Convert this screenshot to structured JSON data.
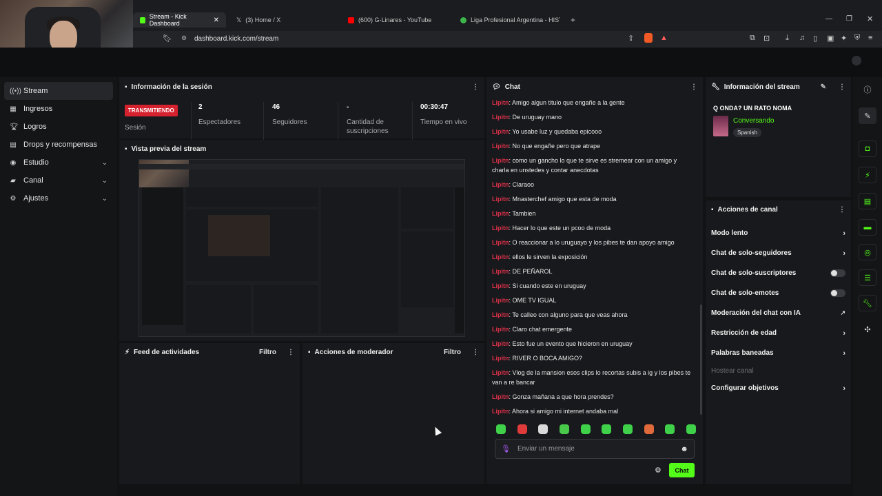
{
  "browser": {
    "tabs": [
      {
        "label": "Stream - Kick Dashboard",
        "active": true,
        "icon": "kick-icon",
        "color": "#53fc18"
      },
      {
        "label": "(3) Home / X",
        "active": false,
        "icon": "x-icon",
        "color": "#ffffff"
      },
      {
        "label": "(600) G-Linares - YouTube",
        "active": false,
        "icon": "youtube-icon",
        "color": "#ff0000"
      },
      {
        "label": "Liga Profesional Argentina - HISTORI",
        "active": false,
        "icon": "lpf-icon",
        "color": "#3db54a"
      }
    ],
    "url": "dashboard.kick.com/stream"
  },
  "sidebar": {
    "items": [
      {
        "label": "Stream",
        "icon": "broadcast-icon",
        "active": true,
        "chevron": false
      },
      {
        "label": "Ingresos",
        "icon": "dollar-icon",
        "active": false,
        "chevron": false
      },
      {
        "label": "Logros",
        "icon": "trophy-icon",
        "active": false,
        "chevron": false
      },
      {
        "label": "Drops y recompensas",
        "icon": "gift-icon",
        "active": false,
        "chevron": false
      },
      {
        "label": "Estudio",
        "icon": "camera-icon",
        "active": false,
        "chevron": true
      },
      {
        "label": "Canal",
        "icon": "user-icon",
        "active": false,
        "chevron": true
      },
      {
        "label": "Ajustes",
        "icon": "gear-icon",
        "active": false,
        "chevron": true
      }
    ]
  },
  "session": {
    "title": "Información de la sesión",
    "badge": "TRANSMITIENDO",
    "badge_label": "Sesión",
    "stats": [
      {
        "value": "2",
        "label": "Espectadores"
      },
      {
        "value": "46",
        "label": "Seguidores"
      },
      {
        "value": "-",
        "label": "Cantidad de suscripciones"
      },
      {
        "value": "00:30:47",
        "label": "Tiempo en vivo"
      }
    ]
  },
  "preview": {
    "title": "Vista previa del stream"
  },
  "activity": {
    "title": "Feed de actividades",
    "filter": "Filtro"
  },
  "moderator": {
    "title": "Acciones de moderador",
    "filter": "Filtro"
  },
  "chat": {
    "title": "Chat",
    "messages": [
      {
        "user": "Lipitn",
        "text": ": Amigo algun titulo que engañe a la gente"
      },
      {
        "user": "Lipitn",
        "text": ": De uruguay mano"
      },
      {
        "user": "Lipitn",
        "text": ": Yo usabe luz y quedaba epicooo"
      },
      {
        "user": "Lipitn",
        "text": ": No que engañe pero que atrape"
      },
      {
        "user": "Lipitn",
        "text": ": como un gancho lo que te sirve es stremear con un amigo y charla en unstedes y contar anecdotas"
      },
      {
        "user": "Lipitn",
        "text": ": Claraoo"
      },
      {
        "user": "Lipitn",
        "text": ": Mnasterchef amigo que esta de moda"
      },
      {
        "user": "Lipitn",
        "text": ": Tambien"
      },
      {
        "user": "Lipitn",
        "text": ": Hacer lo que este un pcoo de moda"
      },
      {
        "user": "Lipitn",
        "text": ": O reaccionar a lo uruguayo y los pibes te dan apoyo amigo"
      },
      {
        "user": "Lipitn",
        "text": ": ellos le sirven la exposición"
      },
      {
        "user": "Lipitn",
        "text": ": DE PEÑAROL"
      },
      {
        "user": "Lipitn",
        "text": ": Si cuando este en uruguay"
      },
      {
        "user": "Lipitn",
        "text": ": OME TV IGUAL"
      },
      {
        "user": "Lipitn",
        "text": ": Te calleo con alguno para que veas ahora"
      },
      {
        "user": "Lipitn",
        "text": ": Claro chat emergente"
      },
      {
        "user": "Lipitn",
        "text": ": Esto fue un evento que hicieron en uruguay"
      },
      {
        "user": "Lipitn",
        "text": ": RIVER O BOCA AMIGO?"
      },
      {
        "user": "Lipitn",
        "text": ": Vlog de la mansion esos clips lo recortas subis a ig y los pibes te van a re bancar"
      },
      {
        "user": "Lipitn",
        "text": ": Gonza mañana a que hora prendes?"
      },
      {
        "user": "Lipitn",
        "text": ": Ahora si amigo mi internet andaba mal"
      }
    ],
    "input_placeholder": "Enviar un mensaje",
    "send_label": "Chat",
    "emote_colors": [
      "#3fd14a",
      "#e03b3b",
      "#d9d9d9",
      "#48c94a",
      "#3fd14a",
      "#3fd14a",
      "#3fd14a",
      "#e06a3b",
      "#3fd14a",
      "#3fd14a"
    ]
  },
  "stream_info": {
    "title": "Información del stream",
    "stream_title": "Q ONDA? UN RATO NOMA",
    "category": "Conversando",
    "language": "Spanish"
  },
  "channel_actions": {
    "title": "Acciones de canal",
    "items": [
      {
        "label": "Modo lento",
        "control": "chevron"
      },
      {
        "label": "Chat de solo-seguidores",
        "control": "chevron"
      },
      {
        "label": "Chat de solo-suscriptores",
        "control": "toggle"
      },
      {
        "label": "Chat de solo-emotes",
        "control": "toggle"
      },
      {
        "label": "Moderación del chat con IA",
        "control": "external"
      },
      {
        "label": "Restricción de edad",
        "control": "chevron"
      },
      {
        "label": "Palabras baneadas",
        "control": "chevron"
      },
      {
        "label": "Hostear canal",
        "control": "disabled"
      },
      {
        "label": "Configurar objetivos",
        "control": "chevron"
      }
    ]
  },
  "colors": {
    "accent": "#53fc18",
    "live": "#d6212f",
    "username": "#e0324b"
  }
}
